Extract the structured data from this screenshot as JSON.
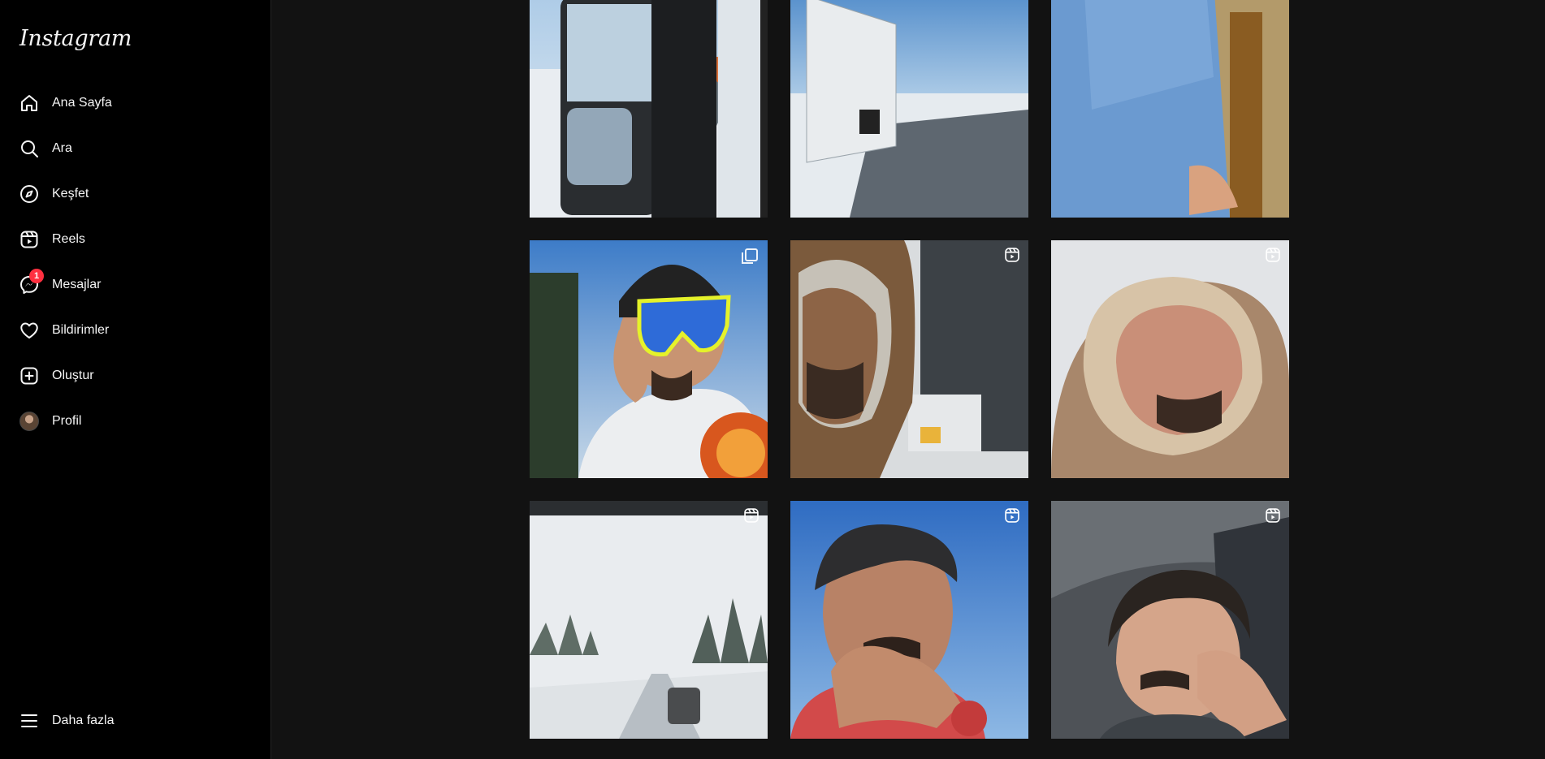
{
  "app": {
    "logo": "Instagram"
  },
  "sidebar": {
    "items": [
      {
        "label": "Ana Sayfa",
        "icon": "home-icon"
      },
      {
        "label": "Ara",
        "icon": "search-icon"
      },
      {
        "label": "Keşfet",
        "icon": "compass-icon"
      },
      {
        "label": "Reels",
        "icon": "reels-icon"
      },
      {
        "label": "Mesajlar",
        "icon": "messenger-icon",
        "badge": "1"
      },
      {
        "label": "Bildirimler",
        "icon": "heart-icon"
      },
      {
        "label": "Oluştur",
        "icon": "plus-square-icon"
      },
      {
        "label": "Profil",
        "icon": "avatar"
      }
    ],
    "more": {
      "label": "Daha fazla",
      "icon": "menu-icon"
    }
  },
  "colors": {
    "background": "#121212",
    "sidebar": "#000000",
    "badge": "#ff3040"
  },
  "posts": [
    {
      "type": "photo",
      "scene": "truck-mirror-snow"
    },
    {
      "type": "photo",
      "scene": "trailer-snow"
    },
    {
      "type": "photo",
      "scene": "man-blue-jacket"
    },
    {
      "type": "carousel",
      "scene": "man-sunglasses"
    },
    {
      "type": "reel",
      "scene": "man-hood-truck"
    },
    {
      "type": "reel",
      "scene": "man-hood-frost"
    },
    {
      "type": "reel",
      "scene": "snowy-road"
    },
    {
      "type": "reel",
      "scene": "man-blue-sky"
    },
    {
      "type": "reel",
      "scene": "man-truck-cab"
    }
  ]
}
